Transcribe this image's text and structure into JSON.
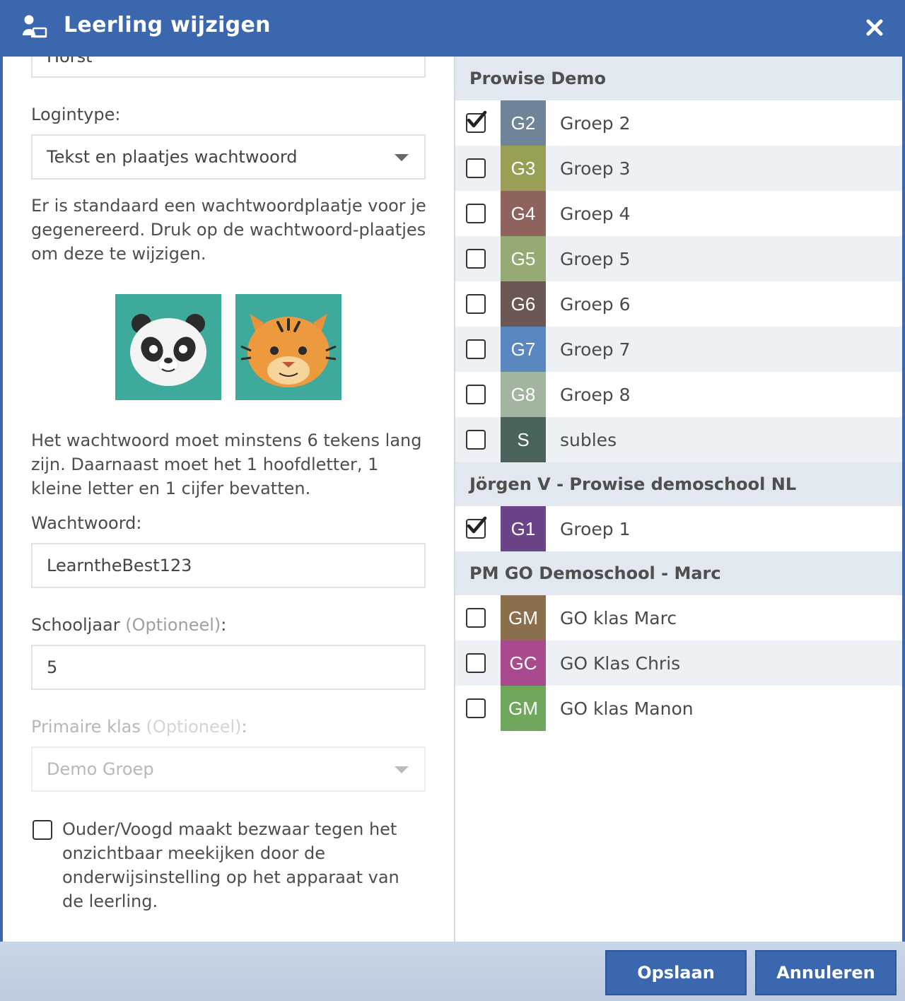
{
  "dialog": {
    "title": "Leerling wijzigen"
  },
  "form": {
    "top_field_value": "Horst",
    "logintype_label": "Logintype:",
    "logintype_value": "Tekst en plaatjes wachtwoord",
    "info_text": "Er is standaard een wachtwoordplaatje voor je gegenereerd. Druk op de wachtwoord-plaatjes om deze te wijzigen.",
    "password_rules": "Het wachtwoord moet minstens 6 tekens lang zijn. Daarnaast moet het 1 hoofdletter, 1 kleine letter en 1 cijfer bevatten.",
    "password_label": "Wachtwoord:",
    "password_value": "LearntheBest123",
    "schooljaar_label": "Schooljaar",
    "optional": "(Optioneel)",
    "colon": ":",
    "schooljaar_value": "5",
    "primary_class_label": "Primaire klas",
    "primary_class_value": "Demo Groep",
    "consent_label": "Ouder/Voogd maakt bezwaar tegen het onzichtbaar meekijken door de onderwijsinstelling op het apparaat van de leerling.",
    "consent_checked": false
  },
  "password_images": [
    {
      "icon": "panda-icon"
    },
    {
      "icon": "tiger-icon"
    }
  ],
  "schools": [
    {
      "name": "Prowise Demo",
      "groups": [
        {
          "code": "G2",
          "name": "Groep 2",
          "color": "#6f8499",
          "checked": true
        },
        {
          "code": "G3",
          "name": "Groep 3",
          "color": "#99a055",
          "checked": false
        },
        {
          "code": "G4",
          "name": "Groep 4",
          "color": "#8e625d",
          "checked": false
        },
        {
          "code": "G5",
          "name": "Groep 5",
          "color": "#96ab73",
          "checked": false
        },
        {
          "code": "G6",
          "name": "Groep 6",
          "color": "#6b5855",
          "checked": false
        },
        {
          "code": "G7",
          "name": "Groep 7",
          "color": "#5a87bf",
          "checked": false
        },
        {
          "code": "G8",
          "name": "Groep 8",
          "color": "#a2b59e",
          "checked": false
        },
        {
          "code": "S",
          "name": "subles",
          "color": "#49625a",
          "checked": false
        }
      ]
    },
    {
      "name": "Jörgen V - Prowise demoschool NL",
      "groups": [
        {
          "code": "G1",
          "name": "Groep 1",
          "color": "#6b4387",
          "checked": true
        }
      ]
    },
    {
      "name": "PM GO Demoschool - Marc",
      "groups": [
        {
          "code": "GM",
          "name": "GO klas Marc",
          "color": "#8b6e4b",
          "checked": false
        },
        {
          "code": "GC",
          "name": "GO Klas Chris",
          "color": "#a94a8f",
          "checked": false
        },
        {
          "code": "GM",
          "name": "GO klas Manon",
          "color": "#6fa75d",
          "checked": false
        }
      ]
    }
  ],
  "footer": {
    "save_label": "Opslaan",
    "cancel_label": "Annuleren"
  }
}
